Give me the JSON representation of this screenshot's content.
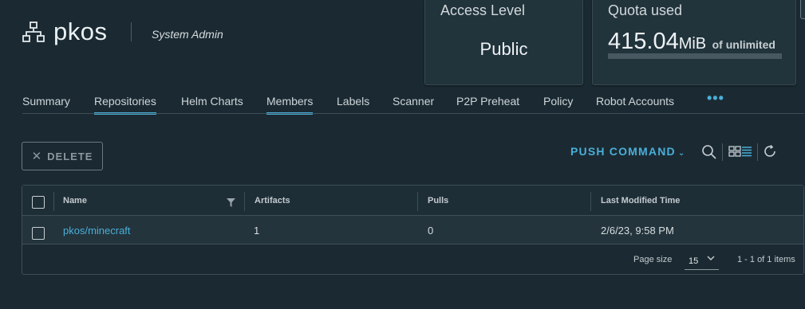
{
  "project": {
    "name": "pkos",
    "role": "System Admin",
    "icon": "project-icon"
  },
  "cards": {
    "access": {
      "title": "Access Level",
      "value": "Public"
    },
    "quota": {
      "title": "Quota used",
      "number": "415.04",
      "unit": "MiB",
      "of_label": "of unlimited",
      "usage_fraction": 0
    }
  },
  "tabs": [
    {
      "label": "Summary",
      "active": false
    },
    {
      "label": "Repositories",
      "active": true
    },
    {
      "label": "Helm Charts",
      "active": false
    },
    {
      "label": "Members",
      "active": true
    },
    {
      "label": "Labels",
      "active": false
    },
    {
      "label": "Scanner",
      "active": false
    },
    {
      "label": "P2P Preheat",
      "active": false
    },
    {
      "label": "Policy",
      "active": false
    },
    {
      "label": "Robot Accounts",
      "active": false
    }
  ],
  "tabs_more_label": "•••",
  "toolbar": {
    "delete_label": "DELETE",
    "push_command_label": "PUSH COMMAND",
    "icons": [
      "search-icon",
      "card-view-icon",
      "list-view-icon",
      "refresh-icon"
    ]
  },
  "table": {
    "columns": [
      "Name",
      "Artifacts",
      "Pulls",
      "Last Modified Time"
    ],
    "rows": [
      {
        "name": "pkos/minecraft",
        "artifacts": "1",
        "pulls": "0",
        "last_modified": "2/6/23, 9:58 PM"
      }
    ],
    "footer": {
      "page_size_label": "Page size",
      "page_size_value": "15",
      "summary": "1 - 1 of 1 items"
    }
  },
  "colors": {
    "background": "#1b2a32",
    "accent": "#4aaed9",
    "card": "#21333b"
  }
}
